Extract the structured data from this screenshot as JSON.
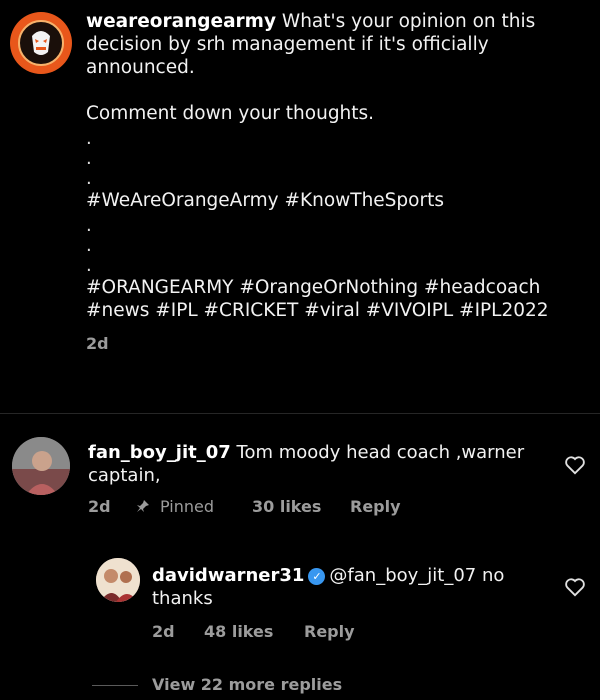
{
  "post": {
    "username": "weareorangearmy",
    "caption_line": "What's your opinion on this decision by srh management if it's officially announced.",
    "caption_line2": "Comment down your thoughts.",
    "dots_a": [
      ".",
      ".",
      "."
    ],
    "hashtags_a": "#WeAreOrangeArmy #KnowTheSports",
    "dots_b": [
      ".",
      ".",
      "."
    ],
    "hashtags_b": "#ORANGEARMY #OrangeOrNothing #headcoach #news #IPL #CRICKET #viral #VIVOIPL #IPL2022",
    "time": "2d"
  },
  "comment": {
    "username": "fan_boy_jit_07",
    "text": "Tom moody head coach ,warner captain,",
    "time": "2d",
    "pinned": "Pinned",
    "likes": "30 likes",
    "reply": "Reply"
  },
  "reply_comment": {
    "username": "davidwarner31",
    "text": "@fan_boy_jit_07 no thanks",
    "time": "2d",
    "likes": "48 likes",
    "reply": "Reply"
  },
  "view_more": "View 22 more replies",
  "colors": {
    "background": "#000000",
    "text": "#f2f2f2",
    "muted": "#9c9c9c",
    "verified": "#3897f0",
    "brand_orange": "#e8571b"
  }
}
